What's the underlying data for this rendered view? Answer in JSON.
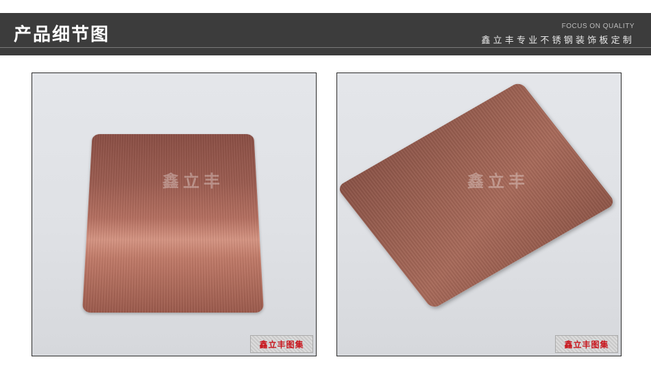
{
  "header": {
    "title": "产品细节图",
    "subtitle_en": "FOCUS ON QUALITY",
    "subtitle_cn": "鑫立丰专业不锈钢装饰板定制"
  },
  "photos": [
    {
      "watermark": "鑫立丰",
      "stamp": "鑫立丰图集"
    },
    {
      "watermark": "鑫立丰",
      "stamp": "鑫立丰图集"
    }
  ],
  "colors": {
    "header_bg": "#3c3c3c",
    "plate_copper": "#9b5c50",
    "stamp_red": "#c8161d"
  }
}
